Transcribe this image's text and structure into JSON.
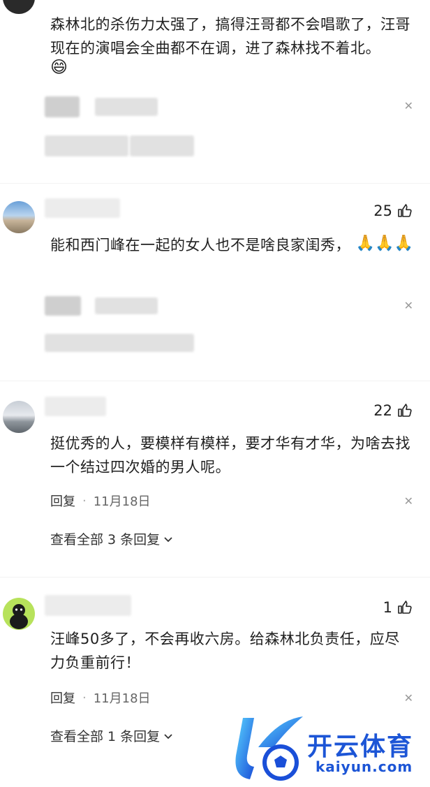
{
  "comments": [
    {
      "text": "森林北的杀伤力太强了，搞得汪哥都不会唱歌了，汪哥现在的演唱会全曲都不在调，进了森林找不着北。",
      "emoji": "😄"
    },
    {
      "likes": "25",
      "text": "能和西门峰在一起的女人也不是啥良家闺秀，",
      "emoji": "🙏🙏🙏"
    },
    {
      "likes": "22",
      "text": "挺优秀的人，要模样有模样，要才华有才华，为啥去找一个结过四次婚的男人呢。",
      "reply_label": "回复",
      "date": "11月18日",
      "view_all": "查看全部 3 条回复"
    },
    {
      "likes": "1",
      "text": "汪峰50多了，不会再收六房。给森林北负责任，应尽力负重前行！",
      "reply_label": "回复",
      "date": "11月18日",
      "view_all": "查看全部 1 条回复"
    }
  ],
  "watermark": {
    "brand": "开云体育",
    "site": "kaiyun.com"
  },
  "icons": {
    "like": "thumbs-up-icon",
    "close": "close-icon",
    "chevron": "chevron-down-icon"
  }
}
